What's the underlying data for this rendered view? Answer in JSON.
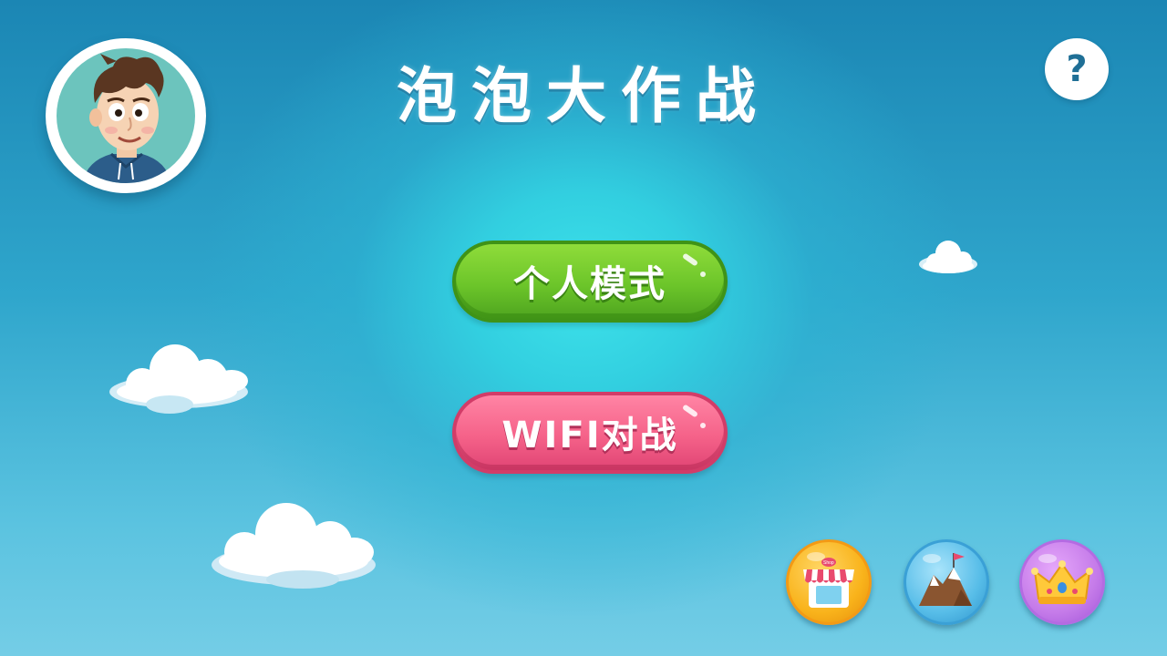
{
  "title": "泡泡大作战",
  "help": {
    "label": "?"
  },
  "menu": {
    "single_player_label": "个人模式",
    "wifi_battle_label": "WIFI对战"
  },
  "bottom_buttons": {
    "shop_sign": "Shop"
  },
  "icons": {
    "avatar": "boy-avatar-icon",
    "help": "question-icon",
    "shop": "shop-icon",
    "map": "mountain-flag-icon",
    "rank": "crown-icon"
  },
  "colors": {
    "green_button": "#6cc52a",
    "pink_button": "#f56289",
    "shop_button": "#f9b31b",
    "map_button": "#57bde8",
    "rank_button": "#c57be9"
  }
}
